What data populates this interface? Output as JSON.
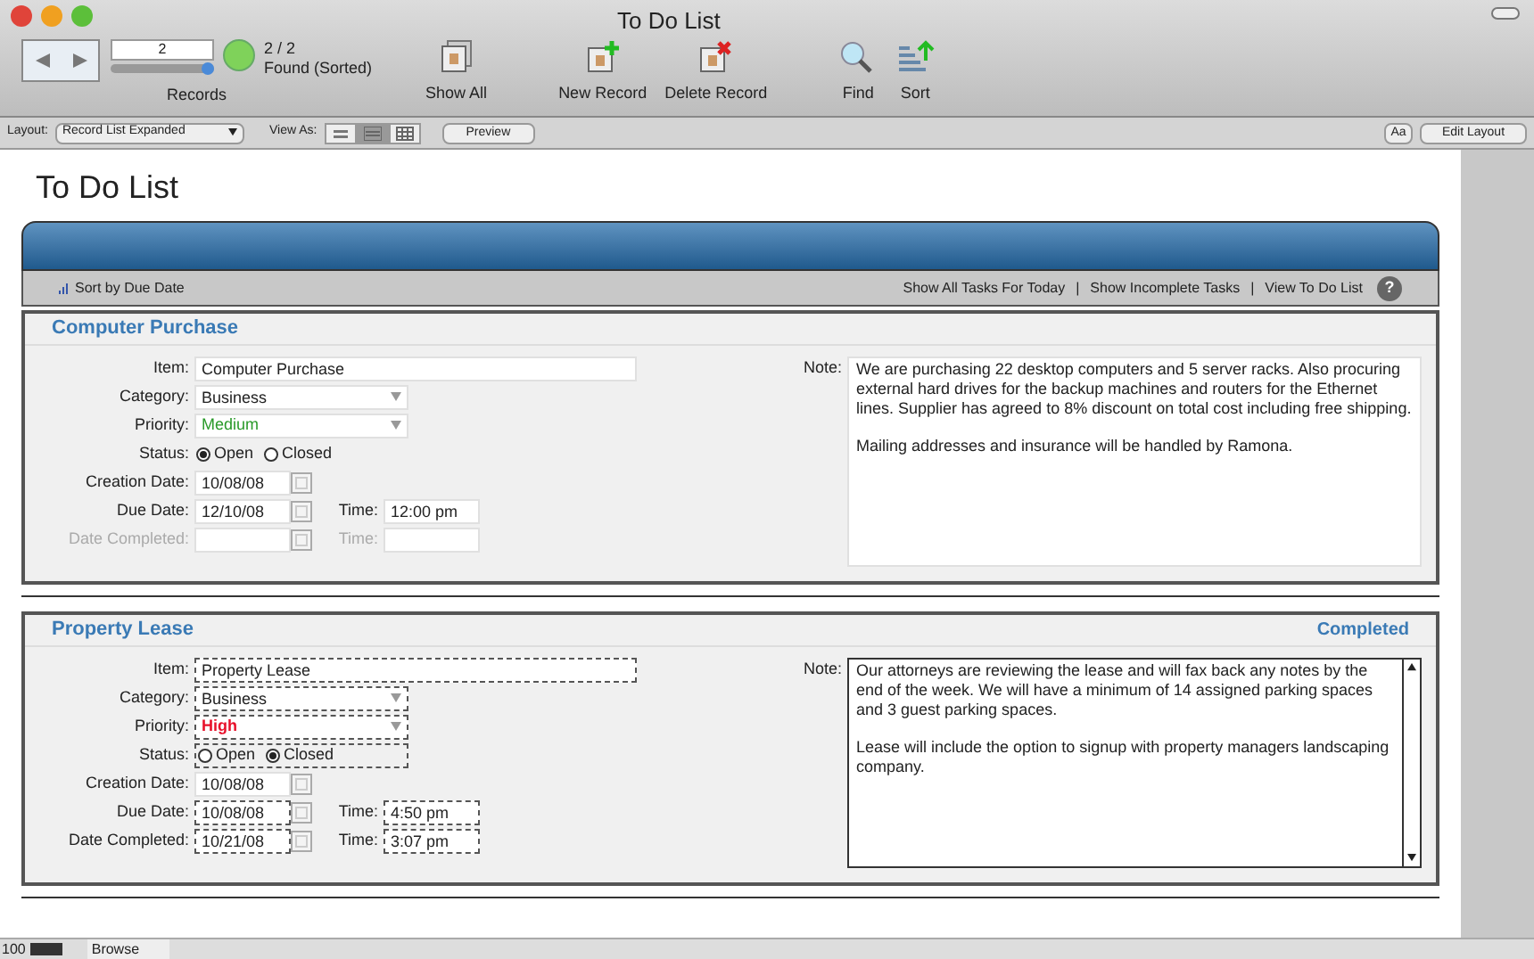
{
  "window": {
    "title": "To Do List"
  },
  "toolbar": {
    "record_number": "2",
    "slider": {
      "level": 1
    },
    "count": "2 / 2",
    "found": "Found (Sorted)",
    "records_label": "Records",
    "buttons": [
      {
        "label": "Show All",
        "kind": "show-all"
      },
      {
        "label": "New Record",
        "kind": "new"
      },
      {
        "label": "Delete Record",
        "kind": "delete"
      },
      {
        "label": "Find",
        "kind": "find"
      },
      {
        "label": "Sort",
        "kind": "sort"
      }
    ]
  },
  "layout_bar": {
    "layout_label": "Layout:",
    "layout": "Record List Expanded",
    "view_as_label": "View As:",
    "views": [
      {
        "kind": "form",
        "selected": false
      },
      {
        "kind": "list",
        "selected": true
      },
      {
        "kind": "table",
        "selected": false
      }
    ],
    "preview": "Preview",
    "font_button": "Aa",
    "edit_layout": "Edit Layout"
  },
  "page_title": "To Do List",
  "header": {
    "sort": "Sort by Due Date",
    "links": [
      "Show All Tasks For Today",
      "Show Incomplete Tasks",
      "View To Do List"
    ],
    "separator": "|",
    "help": "?"
  },
  "records": [
    {
      "title": "Computer Purchase",
      "editing": false,
      "item_label": "Item:",
      "item": "Computer Purchase",
      "category_label": "Category:",
      "category": "Business",
      "priority_label": "Priority:",
      "priority": {
        "value": "Medium",
        "color": "#2a9a2a"
      },
      "status_label": "Status:",
      "status": [
        {
          "label": "Open",
          "selected": true
        },
        {
          "label": "Closed",
          "selected": false
        }
      ],
      "creation_label": "Creation Date:",
      "creation_date": "10/08/08",
      "due_label": "Due Date:",
      "due_date": "12/10/08",
      "time_label": "Time:",
      "due_time": "12:00 pm",
      "completed_label": "Date Completed:",
      "completed_disabled": true,
      "completed_time_label": "Time:",
      "note_label": "Note:",
      "note": [
        "We are purchasing 22 desktop computers and 5 server racks. Also procuring external hard drives for the backup machines and routers for the Ethernet lines. Supplier has agreed to 8% discount on total cost including free shipping.",
        "Mailing addresses and insurance will be handled by Ramona."
      ],
      "note_scroll": false
    },
    {
      "title": "Property Lease",
      "badge": "Completed",
      "editing": true,
      "item_label": "Item:",
      "item": "Property Lease",
      "category_label": "Category:",
      "category": "Business",
      "priority_label": "Priority:",
      "priority": {
        "value": "High",
        "color": "#e8102a"
      },
      "status_label": "Status:",
      "status": [
        {
          "label": "Open",
          "selected": false
        },
        {
          "label": "Closed",
          "selected": true
        }
      ],
      "creation_label": "Creation Date:",
      "creation_date": "10/08/08",
      "due_label": "Due Date:",
      "due_date": "10/08/08",
      "time_label": "Time:",
      "due_time": "4:50 pm",
      "completed_label": "Date Completed:",
      "completed_date": "10/21/08",
      "completed_disabled": false,
      "completed_time_label": "Time:",
      "completed_time": "3:07 pm",
      "note_label": "Note:",
      "note": [
        "Our attorneys are reviewing the lease and will fax back any notes by the end of the week. We will have a minimum of 14 assigned parking spaces and 3 guest parking spaces.",
        "Lease will include the option to signup with property managers landscaping company."
      ],
      "note_scroll": true
    }
  ],
  "status_bar": {
    "zoom": "100",
    "mode": "Browse"
  }
}
